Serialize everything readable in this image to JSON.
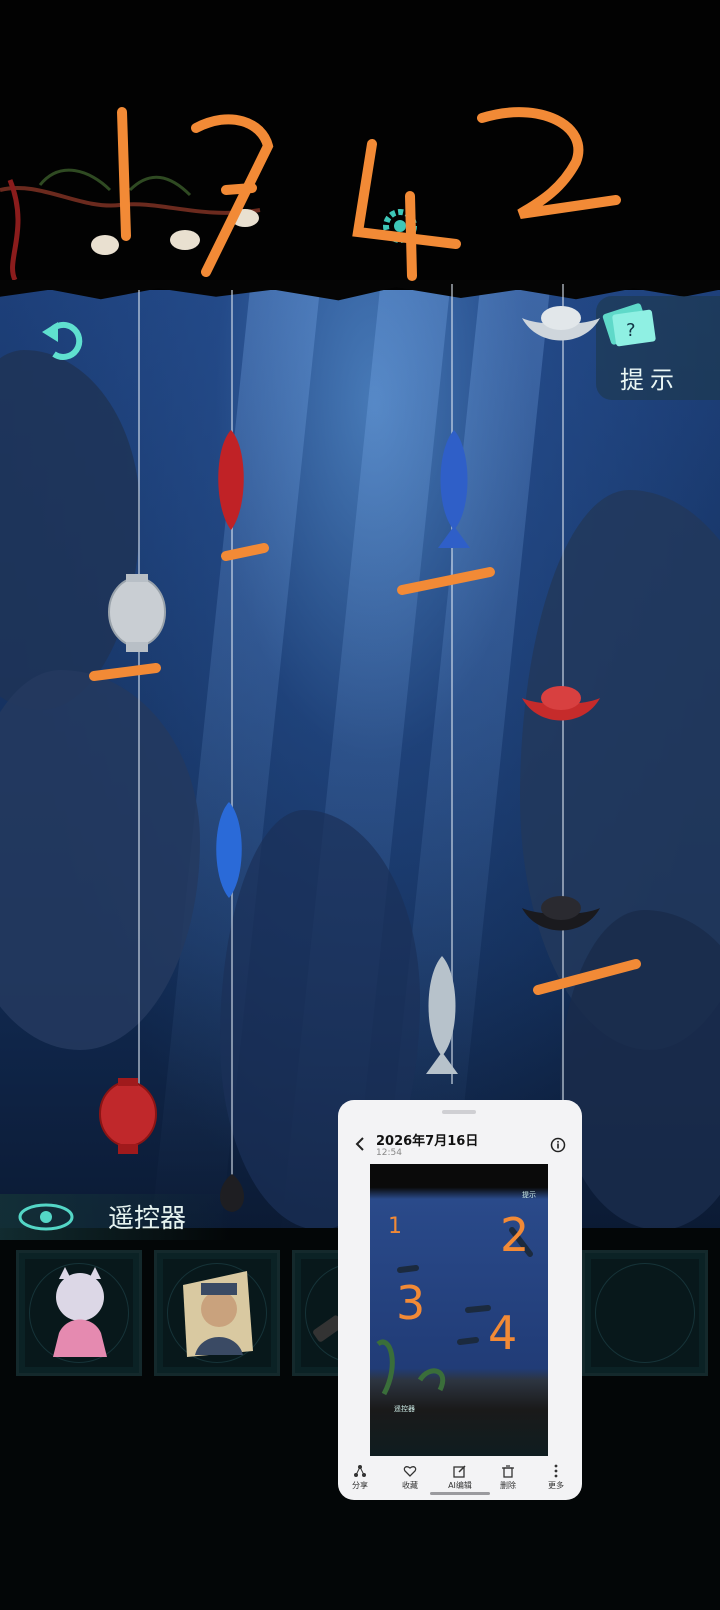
{
  "hint": {
    "label": "提示"
  },
  "inventory": {
    "label": "遥控器"
  },
  "annotations": {
    "top_digits": [
      "1",
      "7",
      "4",
      "2"
    ]
  },
  "gallery": {
    "date": "2026年7月16日",
    "time": "12:54",
    "shot_digits": [
      "1",
      "2",
      "3",
      "4"
    ],
    "shot_label": "遥控器",
    "shot_hint": "提示",
    "actions": [
      "分享",
      "收藏",
      "AI编辑",
      "删除",
      "更多"
    ]
  },
  "colors": {
    "scribble": "#f28a36",
    "accent": "#4fd6c4",
    "water": "#1d3f79"
  }
}
